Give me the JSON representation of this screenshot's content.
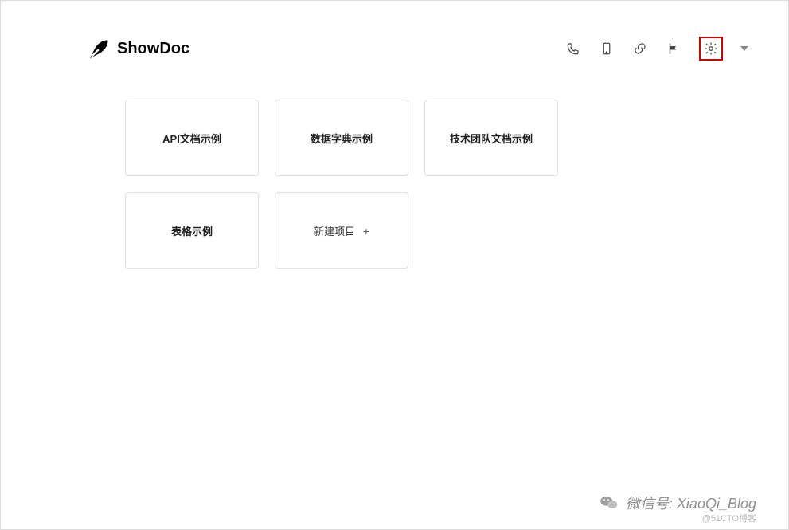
{
  "header": {
    "brand": "ShowDoc"
  },
  "cards": {
    "items": [
      {
        "title": "API文档示例"
      },
      {
        "title": "数据字典示例"
      },
      {
        "title": "技术团队文档示例"
      },
      {
        "title": "表格示例"
      }
    ],
    "new_label": "新建项目"
  },
  "watermark": {
    "text": "微信号: XiaoQi_Blog",
    "attribution": "@51CTO博客"
  }
}
